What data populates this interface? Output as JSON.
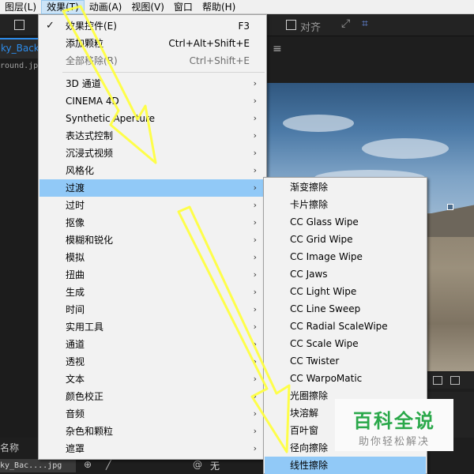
{
  "menubar": {
    "items": [
      "图层(L)",
      "效果(T)",
      "动画(A)",
      "视图(V)",
      "窗口",
      "帮助(H)"
    ],
    "active_index": 1
  },
  "toolbar": {
    "align_label": "对齐"
  },
  "left_panel": {
    "tab_label": "ky_Backgr",
    "file_label": "round.jpg"
  },
  "effect_menu": {
    "items": [
      {
        "label": "效果控件(E)",
        "shortcut": "F3",
        "checked": true,
        "disabled": false,
        "submenu": false
      },
      {
        "label": "添加颗粒",
        "shortcut": "Ctrl+Alt+Shift+E",
        "checked": false,
        "disabled": false,
        "submenu": false
      },
      {
        "label": "全部移除(R)",
        "shortcut": "Ctrl+Shift+E",
        "checked": false,
        "disabled": true,
        "submenu": false
      },
      {
        "label": "3D 通道",
        "submenu": true
      },
      {
        "label": "CINEMA 4D",
        "submenu": true
      },
      {
        "label": "Synthetic Aperture",
        "submenu": true
      },
      {
        "label": "表达式控制",
        "submenu": true
      },
      {
        "label": "沉浸式视频",
        "submenu": true
      },
      {
        "label": "风格化",
        "submenu": true
      },
      {
        "label": "过渡",
        "submenu": true,
        "selected": true
      },
      {
        "label": "过时",
        "submenu": true
      },
      {
        "label": "抠像",
        "submenu": true
      },
      {
        "label": "模糊和锐化",
        "submenu": true
      },
      {
        "label": "模拟",
        "submenu": true
      },
      {
        "label": "扭曲",
        "submenu": true
      },
      {
        "label": "生成",
        "submenu": true
      },
      {
        "label": "时间",
        "submenu": true
      },
      {
        "label": "实用工具",
        "submenu": true
      },
      {
        "label": "通道",
        "submenu": true
      },
      {
        "label": "透视",
        "submenu": true
      },
      {
        "label": "文本",
        "submenu": true
      },
      {
        "label": "颜色校正",
        "submenu": true
      },
      {
        "label": "音频",
        "submenu": true
      },
      {
        "label": "杂色和颗粒",
        "submenu": true
      },
      {
        "label": "遮罩",
        "submenu": true
      }
    ]
  },
  "transition_submenu": {
    "items": [
      "渐变擦除",
      "卡片擦除",
      "CC Glass Wipe",
      "CC Grid Wipe",
      "CC Image Wipe",
      "CC Jaws",
      "CC Light Wipe",
      "CC Line Sweep",
      "CC Radial ScaleWipe",
      "CC Scale Wipe",
      "CC Twister",
      "CC WarpoMatic",
      "光圈擦除",
      "块溶解",
      "百叶窗",
      "径向擦除",
      "线性擦除"
    ],
    "selected_index": 16
  },
  "bottom_panel": {
    "column_label": "名称",
    "file_label": "ky_Bac....jpg",
    "value_label": "无"
  },
  "watermark": {
    "title": "百科全说",
    "subtitle": "助你轻松解决"
  },
  "colors": {
    "menu_bg": "#f2f2f2",
    "menu_highlight": "#91c9f7",
    "menubar_active": "#cce4f7",
    "accent_blue": "#2d8ceb",
    "annotation_arrow": "#ffff3c",
    "watermark_green": "#2aa84a"
  }
}
